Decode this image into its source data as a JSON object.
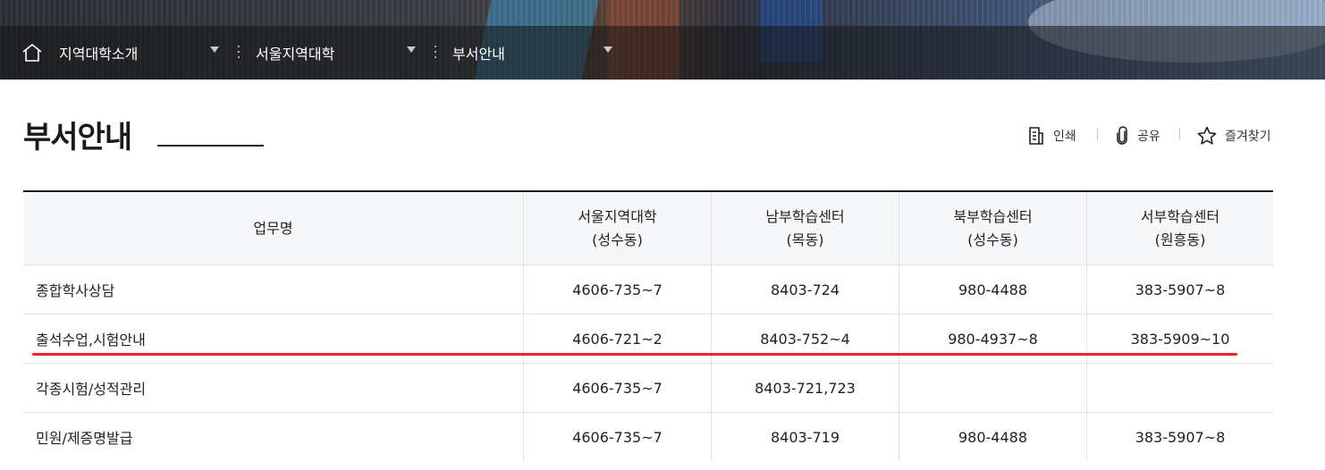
{
  "breadcrumb": [
    {
      "label": "지역대학소개"
    },
    {
      "label": "서울지역대학"
    },
    {
      "label": "부서안내"
    }
  ],
  "page": {
    "title": "부서안내"
  },
  "utilities": {
    "print": "인쇄",
    "share": "공유",
    "favorite": "즐겨찾기"
  },
  "table": {
    "headers": [
      {
        "line1": "업무명",
        "line2": ""
      },
      {
        "line1": "서울지역대학",
        "line2": "(성수동)"
      },
      {
        "line1": "남부학습센터",
        "line2": "(목동)"
      },
      {
        "line1": "북부학습센터",
        "line2": "(성수동)"
      },
      {
        "line1": "서부학습센터",
        "line2": "(원흥동)"
      }
    ],
    "rows": [
      [
        "종합학사상담",
        "4606-735~7",
        "8403-724",
        "980-4488",
        "383-5907~8"
      ],
      [
        "출석수업,시험안내",
        "4606-721~2",
        "8403-752~4",
        "980-4937~8",
        "383-5909~10"
      ],
      [
        "각종시험/성적관리",
        "4606-735~7",
        "8403-721,723",
        "",
        ""
      ],
      [
        "민원/제증명발급",
        "4606-735~7",
        "8403-719",
        "980-4488",
        "383-5907~8"
      ]
    ]
  },
  "colors": {
    "highlight": "#e8232d",
    "header_bg": "#f6f7f9"
  }
}
